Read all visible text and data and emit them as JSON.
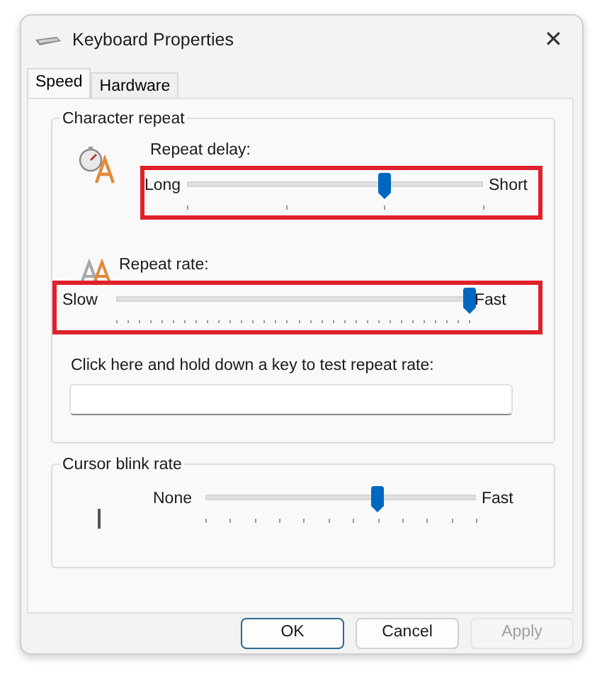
{
  "window": {
    "title": "Keyboard Properties",
    "close": "✕"
  },
  "tabs": [
    {
      "label": "Speed",
      "selected": true
    },
    {
      "label": "Hardware",
      "selected": false
    }
  ],
  "character_repeat": {
    "title": "Character repeat",
    "sliders": [
      {
        "kind": "four-step",
        "label": "Repeat delay:",
        "min_label": "Long",
        "max_label": "Short",
        "level": 0.667,
        "highlighted": true
      },
      {
        "kind": "dense",
        "label": "Repeat rate:",
        "min_label": "Slow",
        "max_label": "Fast",
        "level": 1.0,
        "highlighted": true
      }
    ],
    "test": {
      "label": "Click here and hold down a key to test repeat rate:"
    }
  },
  "cursor_blink": {
    "title": "Cursor blink rate",
    "slider": {
      "kind": "twelve-step",
      "min_label": "None",
      "max_label": "Fast",
      "level": 0.636
    }
  },
  "buttons": [
    {
      "label": "OK",
      "kind": "default",
      "disabled": false
    },
    {
      "label": "Cancel",
      "kind": "normal",
      "disabled": false
    },
    {
      "label": "Apply",
      "kind": "normal",
      "disabled": true
    }
  ]
}
